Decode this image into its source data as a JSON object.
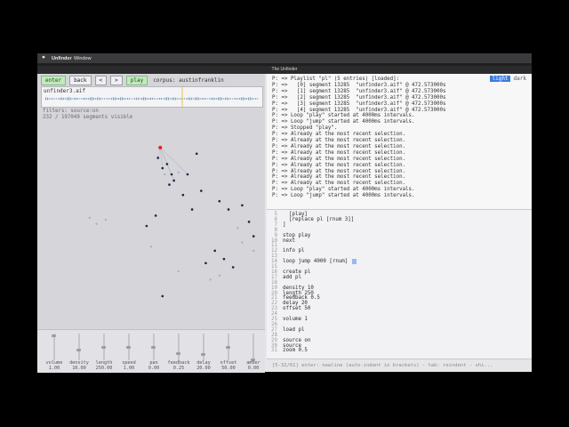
{
  "menubar": {
    "apple": "",
    "app": "Unfinder",
    "window": "Window"
  },
  "window_title": "The Unfinder",
  "toolbar": {
    "enter": "enter",
    "back": "back",
    "prev": "<",
    "next": ">",
    "play": "play",
    "corpus": "corpus: austinfranklin"
  },
  "waveform": {
    "file": "unfinder3.aif"
  },
  "filters": {
    "line1": "filters: source:on",
    "line2": "232 / 197049 segments visible"
  },
  "theme": {
    "light": "light",
    "dark": "dark"
  },
  "log": [
    "P: => Playlist \"pl\" (5 entries) [loaded]:",
    "P: =>   [0] segment 13285  \"unfinder3.aif\" @ 472.573000s",
    "P: =>   [1] segment 13285  \"unfinder3.aif\" @ 472.573000s",
    "P: =>   [2] segment 13285  \"unfinder3.aif\" @ 472.573000s",
    "P: =>   [3] segment 13285  \"unfinder3.aif\" @ 472.573000s",
    "P: =>   [4] segment 13285  \"unfinder3.aif\" @ 472.573000s",
    "P: => Loop \"play\" started at 4000ms intervals.",
    "P: => Loop \"jump\" started at 4000ms intervals.",
    "P: => Stopped \"play\".",
    "P: => Already at the most recent selection.",
    "P: => Already at the most recent selection.",
    "P: => Already at the most recent selection.",
    "P: => Already at the most recent selection.",
    "P: => Already at the most recent selection.",
    "P: => Already at the most recent selection.",
    "P: => Already at the most recent selection.",
    "P: => Already at the most recent selection.",
    "P: => Already at the most recent selection.",
    "P: => Loop \"play\" started at 4000ms intervals.",
    "P: => Loop \"jump\" started at 4000ms intervals."
  ],
  "editor": [
    {
      "n": "5",
      "t": "  [play]"
    },
    {
      "n": "6",
      "t": "  [replace pl [rnum 3]]"
    },
    {
      "n": "7",
      "t": "]"
    },
    {
      "n": "8",
      "t": ""
    },
    {
      "n": "9",
      "t": "stop play"
    },
    {
      "n": "10",
      "t": "next"
    },
    {
      "n": "11",
      "t": ""
    },
    {
      "n": "12",
      "t": "info pl"
    },
    {
      "n": "13",
      "t": ""
    },
    {
      "n": "14",
      "t": "loop jump 4000 [rnum]"
    },
    {
      "n": "15",
      "t": ""
    },
    {
      "n": "16",
      "t": "create pl"
    },
    {
      "n": "17",
      "t": "add pl"
    },
    {
      "n": "18",
      "t": ""
    },
    {
      "n": "19",
      "t": "density 10"
    },
    {
      "n": "20",
      "t": "length 250"
    },
    {
      "n": "21",
      "t": "feedback 0.5"
    },
    {
      "n": "22",
      "t": "delay 20"
    },
    {
      "n": "23",
      "t": "offset 50"
    },
    {
      "n": "24",
      "t": ""
    },
    {
      "n": "25",
      "t": "volume 1"
    },
    {
      "n": "26",
      "t": ""
    },
    {
      "n": "27",
      "t": "load pl"
    },
    {
      "n": "28",
      "t": ""
    },
    {
      "n": "29",
      "t": "source on"
    },
    {
      "n": "30",
      "t": "source"
    },
    {
      "n": "31",
      "t": "zoom 0.5"
    }
  ],
  "status": "[5-32/61]  enter: newline (auto-indent in brackets) - tab: reindent - shi...",
  "sliders": [
    {
      "label": "volume",
      "value": "1.00",
      "level": 0.95
    },
    {
      "label": "density",
      "value": "10.00",
      "level": 0.4
    },
    {
      "label": "length",
      "value": "250.00",
      "level": 0.5
    },
    {
      "label": "speed",
      "value": "1.00",
      "level": 0.5
    },
    {
      "label": "pan",
      "value": "0.00",
      "level": 0.5
    },
    {
      "label": "feedback",
      "value": "0.25",
      "level": 0.25
    },
    {
      "label": "delay",
      "value": "20.00",
      "level": 0.2
    },
    {
      "label": "offset",
      "value": "50.00",
      "level": 0.5
    },
    {
      "label": "amber",
      "value": "0.00",
      "level": 0.0
    }
  ],
  "scatter": {
    "selected_color": "#e02020",
    "dark_color": "#1b2340",
    "light_color": "#9ab0c8",
    "points_dark": [
      [
        0.53,
        0.17
      ],
      [
        0.55,
        0.22
      ],
      [
        0.57,
        0.2
      ],
      [
        0.59,
        0.25
      ],
      [
        0.6,
        0.28
      ],
      [
        0.66,
        0.25
      ],
      [
        0.7,
        0.15
      ],
      [
        0.64,
        0.35
      ],
      [
        0.72,
        0.33
      ],
      [
        0.8,
        0.38
      ],
      [
        0.84,
        0.42
      ],
      [
        0.9,
        0.4
      ],
      [
        0.93,
        0.48
      ],
      [
        0.95,
        0.55
      ],
      [
        0.52,
        0.45
      ],
      [
        0.48,
        0.5
      ],
      [
        0.78,
        0.62
      ],
      [
        0.82,
        0.66
      ],
      [
        0.86,
        0.7
      ],
      [
        0.74,
        0.68
      ],
      [
        0.55,
        0.84
      ],
      [
        0.68,
        0.42
      ],
      [
        0.58,
        0.3
      ]
    ],
    "points_light": [
      [
        0.56,
        0.25
      ],
      [
        0.62,
        0.24
      ],
      [
        0.26,
        0.49
      ],
      [
        0.23,
        0.46
      ],
      [
        0.3,
        0.47
      ],
      [
        0.88,
        0.51
      ],
      [
        0.9,
        0.58
      ],
      [
        0.95,
        0.62
      ],
      [
        0.76,
        0.76
      ],
      [
        0.8,
        0.74
      ],
      [
        0.5,
        0.6
      ],
      [
        0.62,
        0.72
      ]
    ],
    "selected_point": [
      0.54,
      0.12
    ]
  }
}
